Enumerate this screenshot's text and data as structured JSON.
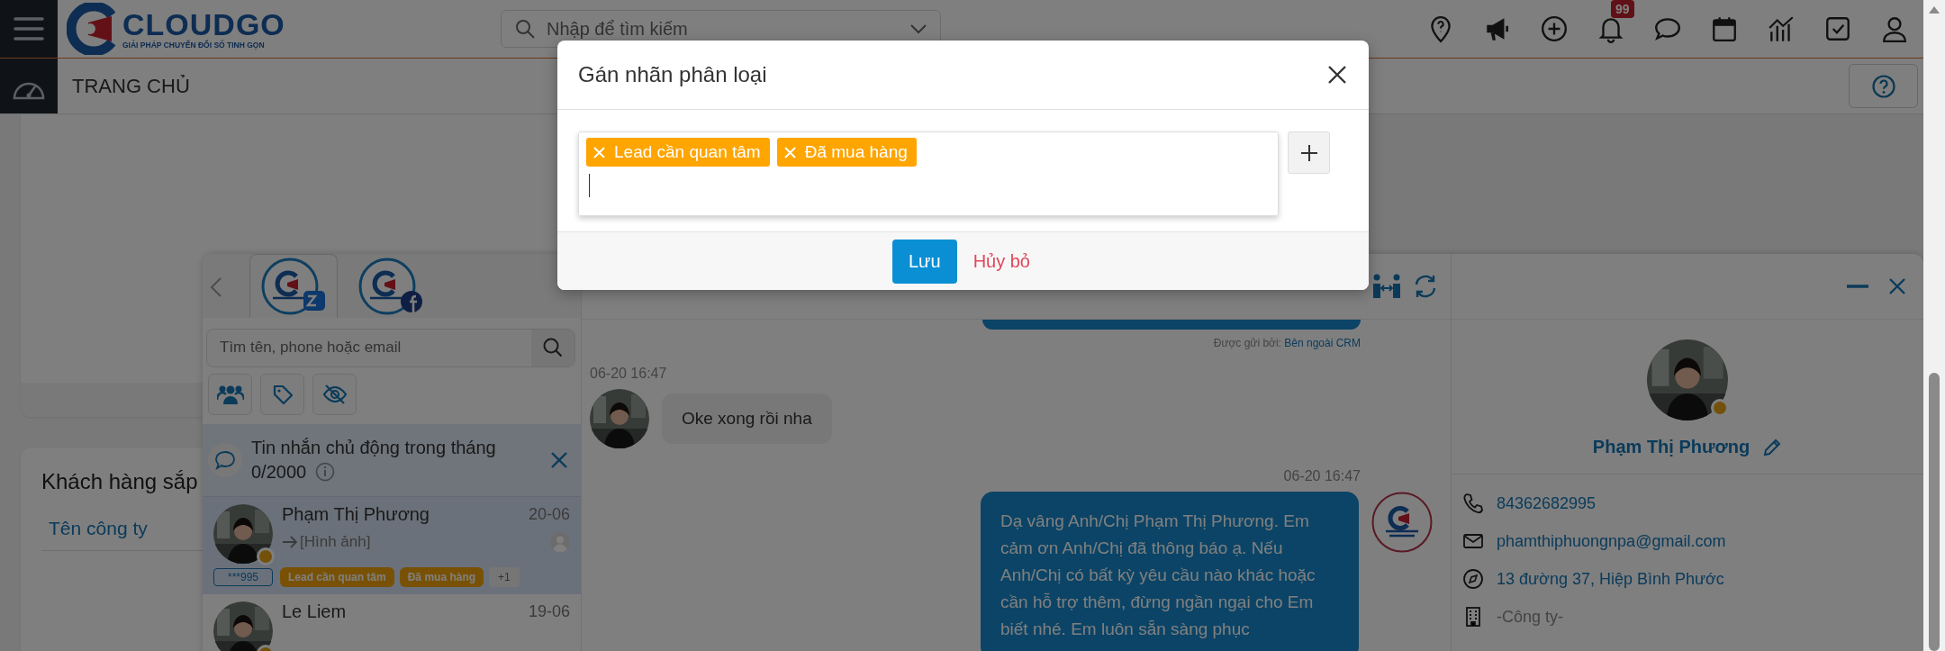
{
  "top_bar": {
    "logo": {
      "name": "CLOUDGO",
      "tagline": "GIẢI PHÁP CHUYỂN ĐỔI SỐ TINH GỌN"
    },
    "search": {
      "placeholder": "Nhập để tìm kiếm"
    },
    "notification_badge": "99"
  },
  "page_header": {
    "title": "TRANG CHỦ"
  },
  "dashboard": {
    "card_title": "Khách hàng sắp",
    "column_header": "Tên công ty"
  },
  "chat": {
    "channel_tabs": [
      {
        "kind": "zalo",
        "selected": true
      },
      {
        "kind": "facebook",
        "selected": false
      }
    ],
    "search": {
      "placeholder": "Tìm tên, phone hoặc email"
    },
    "notice": {
      "text": "Tin nhắn chủ động trong tháng",
      "count": "0/2000"
    },
    "conversations": [
      {
        "name": "Phạm Thị Phương",
        "date": "20-06",
        "preview": "[Hình ảnh]",
        "phone_badge": "***995",
        "tags": [
          "Lead cần quan tâm",
          "Đã mua hàng"
        ],
        "more": "+1",
        "selected": true
      },
      {
        "name": "Le Liem",
        "date": "19-06",
        "selected": false
      }
    ],
    "messages": [
      {
        "kind": "sent_by",
        "label": "Được gửi bởi:",
        "sender": "Bên ngoài CRM"
      },
      {
        "kind": "time_in",
        "text": "06-20 16:47"
      },
      {
        "kind": "incoming",
        "text": "Oke xong rồi nha"
      },
      {
        "kind": "time_out",
        "text": "06-20 16:47"
      },
      {
        "kind": "outgoing",
        "text": "Dạ vâng Anh/Chị Phạm Thị Phương. Em cảm ơn Anh/Chị đã thông báo ạ. Nếu Anh/Chị có bất kỳ yêu cầu nào khác hoặc cần hỗ trợ thêm, đừng ngần ngại cho Em biết nhé. Em luôn sẵn sàng phục"
      }
    ],
    "profile": {
      "name": "Phạm Thị Phương",
      "details": [
        {
          "kind": "phone",
          "text": "84362682995",
          "empty": false
        },
        {
          "kind": "email",
          "text": "phamthiphuongnpa@gmail.com",
          "empty": false
        },
        {
          "kind": "address",
          "text": "13 đường 37, Hiệp Bình Phước",
          "empty": false
        },
        {
          "kind": "company",
          "text": "-Công ty-",
          "empty": true
        }
      ]
    }
  },
  "modal": {
    "title": "Gán nhãn phân loại",
    "tags": [
      {
        "label": "Lead cần quan tâm"
      },
      {
        "label": "Đã mua hàng"
      }
    ],
    "buttons": [
      {
        "kind": "primary",
        "label": "Lưu"
      },
      {
        "kind": "cancel",
        "label": "Hủy bỏ"
      }
    ]
  }
}
